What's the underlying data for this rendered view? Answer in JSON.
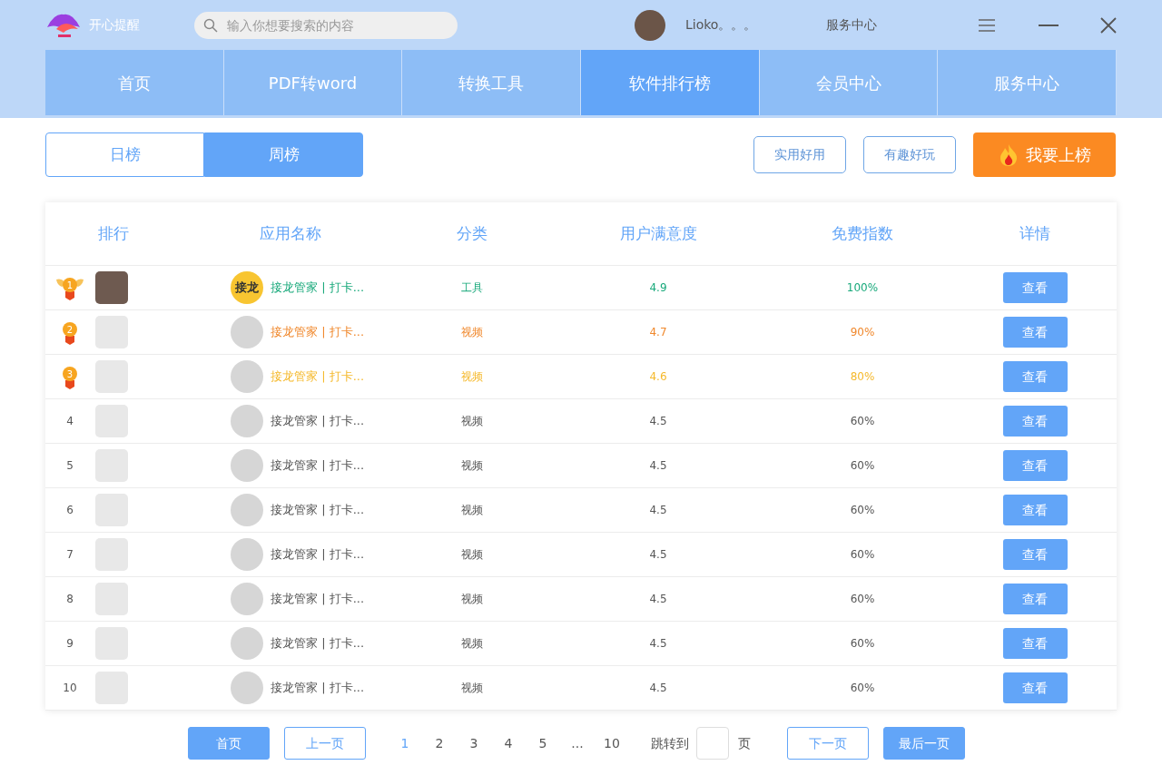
{
  "app": {
    "name": "开心提醒"
  },
  "search": {
    "placeholder": "输入你想要搜索的内容"
  },
  "user": {
    "name": "Lioko。。。"
  },
  "top_link": "服务中心",
  "nav": [
    {
      "label": "首页",
      "selected": false
    },
    {
      "label": "PDF转word",
      "selected": false
    },
    {
      "label": "转换工具",
      "selected": false
    },
    {
      "label": "软件排行榜",
      "selected": true
    },
    {
      "label": "会员中心",
      "selected": false
    },
    {
      "label": "服务中心",
      "selected": false
    }
  ],
  "period_tabs": [
    {
      "label": "日榜",
      "selected": false
    },
    {
      "label": "周榜",
      "selected": true
    }
  ],
  "filters": [
    "实用好用",
    "有趣好玩"
  ],
  "cta": "我要上榜",
  "table": {
    "columns": [
      "排行",
      "应用名称",
      "分类",
      "用户满意度",
      "免费指数",
      "详情"
    ],
    "rows": [
      {
        "kind": "medal",
        "rank": "1",
        "thumb_photo": true,
        "logo": "接龙",
        "name": "接龙管家 | 打卡...",
        "category": "工具",
        "rating": "4.9",
        "free": "100%",
        "action": "查看",
        "color": "#19a97b"
      },
      {
        "kind": "medal",
        "rank": "2",
        "thumb_photo": false,
        "name": "接龙管家 | 打卡...",
        "category": "视频",
        "rating": "4.7",
        "free": "90%",
        "action": "查看",
        "color": "#f0882c"
      },
      {
        "kind": "medal",
        "rank": "3",
        "thumb_photo": false,
        "name": "接龙管家 | 打卡...",
        "category": "视频",
        "rating": "4.6",
        "free": "80%",
        "action": "查看",
        "color": "#f5b92c"
      },
      {
        "kind": "plain",
        "rank": "4",
        "thumb_photo": false,
        "name": "接龙管家 | 打卡...",
        "category": "视频",
        "rating": "4.5",
        "free": "60%",
        "action": "查看",
        "color": "#555555"
      },
      {
        "kind": "plain",
        "rank": "5",
        "thumb_photo": false,
        "name": "接龙管家 | 打卡...",
        "category": "视频",
        "rating": "4.5",
        "free": "60%",
        "action": "查看",
        "color": "#555555"
      },
      {
        "kind": "plain",
        "rank": "6",
        "thumb_photo": false,
        "name": "接龙管家 | 打卡...",
        "category": "视频",
        "rating": "4.5",
        "free": "60%",
        "action": "查看",
        "color": "#555555"
      },
      {
        "kind": "plain",
        "rank": "7",
        "thumb_photo": false,
        "name": "接龙管家 | 打卡...",
        "category": "视频",
        "rating": "4.5",
        "free": "60%",
        "action": "查看",
        "color": "#555555"
      },
      {
        "kind": "plain",
        "rank": "8",
        "thumb_photo": false,
        "name": "接龙管家 | 打卡...",
        "category": "视频",
        "rating": "4.5",
        "free": "60%",
        "action": "查看",
        "color": "#555555"
      },
      {
        "kind": "plain",
        "rank": "9",
        "thumb_photo": false,
        "name": "接龙管家 | 打卡...",
        "category": "视频",
        "rating": "4.5",
        "free": "60%",
        "action": "查看",
        "color": "#555555"
      },
      {
        "kind": "plain",
        "rank": "10",
        "thumb_photo": false,
        "name": "接龙管家 | 打卡...",
        "category": "视频",
        "rating": "4.5",
        "free": "60%",
        "action": "查看",
        "color": "#555555"
      }
    ]
  },
  "pagination": {
    "first": "首页",
    "prev": "上一页",
    "pages": [
      {
        "label": "1",
        "selected": true
      },
      {
        "label": "2",
        "selected": false
      },
      {
        "label": "3",
        "selected": false
      },
      {
        "label": "4",
        "selected": false
      },
      {
        "label": "5",
        "selected": false
      },
      {
        "label": "...",
        "selected": false
      },
      {
        "label": "10",
        "selected": false
      }
    ],
    "jump_label": "跳转到",
    "jump_suffix": "页",
    "next": "下一页",
    "last": "最后一页"
  }
}
